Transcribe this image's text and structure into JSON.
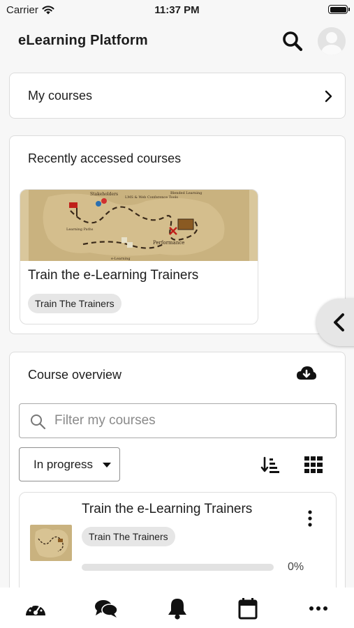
{
  "status_bar": {
    "carrier": "Carrier",
    "time": "11:37 PM"
  },
  "header": {
    "title": "eLearning Platform",
    "search_icon": "search-icon",
    "avatar_icon": "user-avatar"
  },
  "my_courses": {
    "label": "My courses"
  },
  "recent": {
    "title": "Recently accessed courses",
    "course": {
      "name": "Train the e-Learning Trainers",
      "category": "Train The Trainers",
      "map_labels": [
        "Stakeholders",
        "LMS & Web Conference Tools",
        "Blended Learning",
        "Learning Paths",
        "Performance",
        "e-Learning"
      ]
    }
  },
  "overview": {
    "title": "Course overview",
    "filter_placeholder": "Filter my courses",
    "grouping": "In progress",
    "course": {
      "name": "Train the e-Learning Trainers",
      "category": "Train The Trainers",
      "progress": 0,
      "progress_text": "0%"
    }
  },
  "tabs": [
    "dashboard-icon",
    "messages-icon",
    "notifications-icon",
    "calendar-icon",
    "more-icon"
  ],
  "colors": {
    "accent": "#0f6cbf",
    "badge_bg": "#e6e6e6",
    "map_bg": "#c9b27f"
  }
}
